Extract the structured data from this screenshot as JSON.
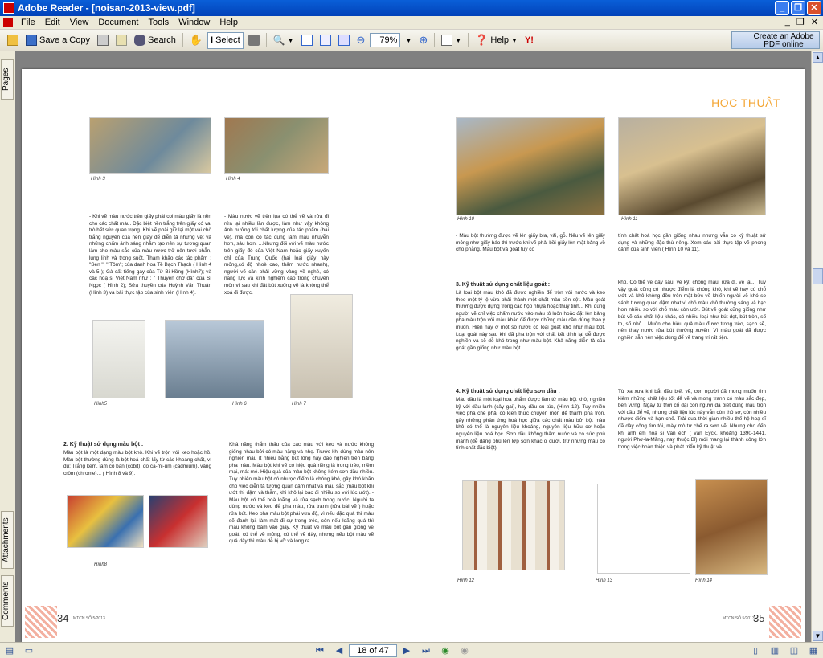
{
  "window": {
    "title": "Adobe Reader - [noisan-2013-view.pdf]"
  },
  "menu": [
    "File",
    "Edit",
    "View",
    "Document",
    "Tools",
    "Window",
    "Help"
  ],
  "toolbar": {
    "save_copy": "Save a Copy",
    "search": "Search",
    "select": "Select",
    "zoom": "79%",
    "help": "Help",
    "create_pdf": "Create an Adobe PDF online"
  },
  "sidebar": {
    "tabs": [
      "Pages",
      "Attachments",
      "Comments"
    ]
  },
  "document": {
    "section_heading": "HỌC THUẬT",
    "left_page_number": "34",
    "right_page_number": "35",
    "footer_left": "MTCN SỐ 5/2013",
    "footer_right": "MTCN SỐ 5/2013",
    "captions": [
      "Hình 3",
      "Hình 4",
      "Hình5",
      "Hình 6",
      "Hình 7",
      "Hình8",
      "Hình 10",
      "Hình 11",
      "Hình 12",
      "Hình 13",
      "Hình 14"
    ],
    "left_col1_text": "- Khi vẽ màu nước trên giấy phải coi màu giấy là nền cho các chất màu. Đặc biệt nền trắng trên giấy có vai trò hết sức quan trọng. Khi vẽ phải giữ lại một vài chỗ trắng nguyên của nền giấy để diễn tả những vệt và những chấm ánh sáng nhằm tạo nên sự tương quan làm cho màu sắc của màu nước trở nên tươi phẳn, lung linh và trong suốt. Tham khảo các tác phẩm : \"Sen \"; \" Tôm\"; của danh hoạ Tề Bạch Thạch ( Hình 4 và 5 ); Gà cất tiếng gáy của Từ Bi Hồng (Hình7); và các hoạ sĩ Việt Nam như : \" Thuyền chờ đá\" của Sĩ Ngọc ( Hình 2); Sửa thuyền của Huỳnh Văn Thuận (Hình 3) và bài thực tập của sinh viên (Hình 4).",
    "left_col2_text": "- Màu nước vẽ trên lụa có thể vẽ và rửa đi rửa lại nhiều lần được, làm như vậy không ảnh hưởng tới chất lượng của tác phẩm (bài vẽ), mà còn có tác dụng làm màu nhuyễn hơn, sâu hơn. ...Nhưng đối với vẽ màu nước trên giấy đó của Việt Nam hoặc giấy xuyến chỉ của Trung Quốc (hai loại giấy này mỏng,có độ nhoè cao, thấm nước nhanh), người vẽ cần phải vững vàng về nghề, có năng lực và kinh nghiệm cao trong chuyên môn vì sau khi đặt bút xuống vẽ là không thể xoá đi được.",
    "left_sec2_title": "2. Kỹ thuật sử dụng màu bột :",
    "left_sec2_text": "Màu bột là một dạng màu bột khô. Khi vẽ trộn với keo hoặc hồ. Màu bột thường dùng là bột hoá chất lấy từ các khoáng chất, ví dụ: Trắng kẽm, lam cô ban (cobit), đỏ ca-mi-um (cadmium), vàng crôm (chrome)... ( Hình 8 và 9).",
    "left_col2b_text": "Khả năng thẩm thấu của các màu với keo và nước không giống nhau bởi có màu nặng và nhẹ. Trước khi dùng màu nên nghiền màu ít nhiều bằng bút lông hay dao nghiền trên bảng pha màu. Màu bột khi vẽ có hiệu quả riêng là trong trẻo, mềm mại, mát mẻ. Hiệu quả của màu bột không kém sơn dầu nhiều. Tuy nhiên màu bột có nhược điểm là chóng khô, gây khó khăn cho việc diễn tả tương quan đậm nhạt và màu sắc (màu bột khi ướt thì đậm và thẫm, khi khô lại bạc đi nhiều so với lúc ướt). - Màu bột có thể hoà loãng và rửa sạch trong nước. Người ta dùng nước và keo để pha màu, rửa tranh (rửa bài vẽ ) hoặc rửa bút. Keo pha màu bột phải vừa độ, vì nếu đặc quá thì màu sẽ đanh lại, làm mất đi sự trong trẻo, còn nếu loãng quá thì màu không bám vào giấy. Kỹ thuật vẽ màu bột gần giống vẽ goát, có thể vẽ mỏng, có thể vẽ dày, nhưng nếu bột màu vẽ quá dày thì màu dễ bị vỡ và long ra.",
    "right_col1_text": "- Màu bột thường được vẽ lên giấy bìa, vải, gỗ. Nếu vẽ lên giấy mỏng như giấy báo thì trước khi vẽ phải bồi giấy lên mặt bảng về cho phẳng. Màu bột và goát tuy có",
    "right_col2_text": "tính chất hoá học gần giống nhau nhưng vẫn có kỹ thuật sử dụng và những đặc thù riêng. Xem các bài thực tập vẽ phong cảnh của sinh viên ( Hình 10 và 11).",
    "right_sec3_title": "3. Kỹ thuật sử dụng chất liệu goát :",
    "right_sec3_text": "Là loại bột màu khô đã được nghiền để trộn với nước và keo theo một tỷ lệ vừa phải thành một chất màu sền sệt. Màu goát thường được đựng trong các hộp nhựa hoặc thuỷ tinh... Khi dùng người vẽ chỉ việc chấm nước vào màu tô luôn hoặc đặt lên bảng pha màu trộn với màu khác để được những màu cần dùng theo ý muốn. Hiện nay ở một số nước có loại goát khô như màu bột. Loại goát này sau khi đã pha trộn với chất kết dính lại dễ được nghiền và sẽ dễ khó trong như màu bột. Khả năng diễn tả của goát gần giống như màu bột",
    "right_col2b_text": "khô. Có thể vẽ dầy sâu, vẽ kỹ, chồng màu, rửa đi, vẽ lại... Tuy vậy goát cũng có nhược điểm là chóng khô, khi vẽ hay có chỗ ướt và khô không đều trên mặt bức vẽ khiến người vẽ khó so sánh tương quan đậm nhạt vì chỗ màu khô thường sáng và bạc hơn nhiều so với chỗ màu còn ướt. Bút vẽ goát cũng giống như bút vẽ các chất liệu khác, có nhiều loại như bút dẹt, bút tròn, số to, số nhỏ... Muốn cho hiệu quả màu được trong trẻo, sạch sẽ, nên thay nước rửa bút thường xuyên. Vì màu goát đã được nghiền sẵn nên việc dùng để vẽ trang trí rất tiện.",
    "right_sec4_title": "4. Kỹ thuật sử dụng chất liệu sơn dầu :",
    "right_sec4_text": "Màu dầu là một loại hoạ phẩm được làm từ màu bột khô, nghiền kỹ với dầu lanh (cây gai), hay dầu cù túc, (Hình 12). Tuy nhiên việc pha chế phải có kiến thức chuyên môn để thành pha trộn, gây những phản ứng hoá học giữa các chất màu bởi bột màu khô có thể là nguyên liệu khoáng, nguyên liệu hữu cơ hoặc nguyên liệu hoá học. Sơn dầu không thấm nước và có sức phủ mạnh (dễ dàng phủ lên lớp sơn khác ở dưới, trừ những màu có tính chất đặc biệt).",
    "right_col2c_text": "Từ xa xưa khi bắt đầu biết vẽ, con người đã mong muốn tìm kiếm những chất liệu tốt để vẽ và mong tranh có màu sắc đẹp, bền vững. Ngay từ thời cổ đại con người đã biết dùng màu trộn với dầu để vẽ, nhưng chất liệu lúc này vẫn còn thô sơ, còn nhiều nhược điểm và hạn chế. Trải qua thời gian nhiều thế hệ hoạ sĩ đã dày công tìm tòi, mày mò tự chế ra sơn vẽ. Nhưng cho đến khi anh em hoạ sĩ Van éch ( van Eyck, khoảng 1390-1441, người Phơ-la-Măng, nay thuộc Bỉ) mới mang lại thành công lớn trong việc hoàn thiện và phát triển kỹ thuật và"
  },
  "status": {
    "page_indicator": "18 of 47"
  }
}
